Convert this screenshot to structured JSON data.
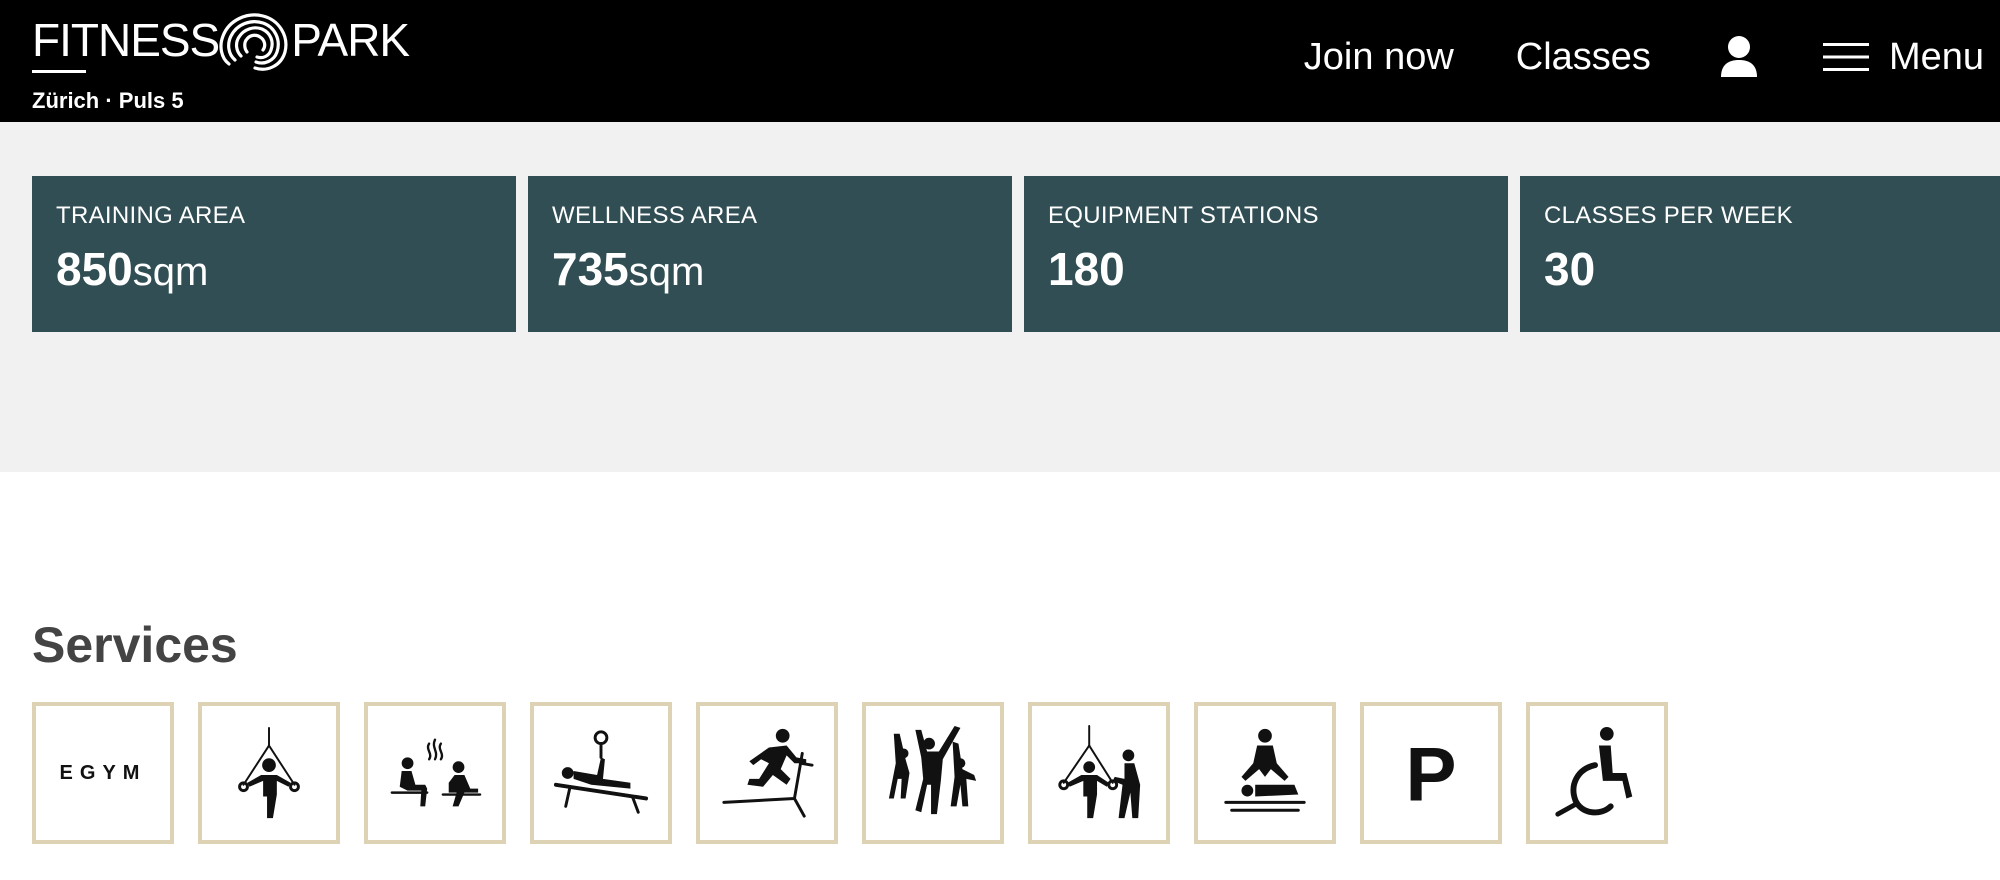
{
  "header": {
    "logo": {
      "left_word": "FITNESS",
      "right_word": "PARK"
    },
    "location": "Zürich · Puls 5",
    "nav": {
      "join_now": "Join now",
      "classes": "Classes",
      "menu": "Menu"
    },
    "icons": [
      "fitness-park-swirl-logo",
      "user-icon",
      "hamburger-menu-icon"
    ]
  },
  "stats": [
    {
      "label": "TRAINING AREA",
      "number": "850",
      "unit": "sqm"
    },
    {
      "label": "WELLNESS AREA",
      "number": "735",
      "unit": "sqm"
    },
    {
      "label": "EQUIPMENT STATIONS",
      "number": "180",
      "unit": ""
    },
    {
      "label": "CLASSES PER WEEK",
      "number": "30",
      "unit": ""
    }
  ],
  "services": {
    "title": "Services",
    "egym_label": "EGYM",
    "parking_label": "P",
    "icons": [
      "egym-icon",
      "suspension-training-icon",
      "sauna-icon",
      "weight-bench-icon",
      "treadmill-icon",
      "group-class-icon",
      "personal-training-icon",
      "massage-icon",
      "parking-icon",
      "wheelchair-accessible-icon"
    ]
  },
  "colors": {
    "header_bg": "#000000",
    "stat_card_bg": "#304e53",
    "stats_band_bg": "#f1f1f1",
    "tile_border": "#ddd3b4",
    "heading_text": "#444444"
  }
}
